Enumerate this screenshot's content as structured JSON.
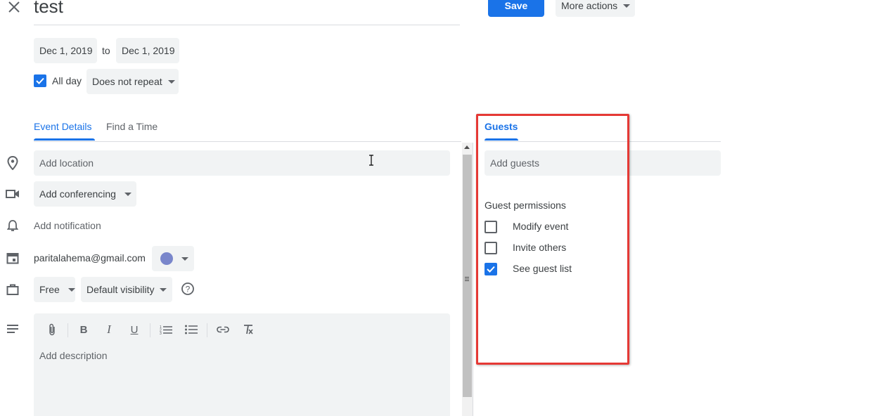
{
  "header": {
    "close_icon": "close-icon",
    "title": "test",
    "save_label": "Save",
    "more_actions_label": "More actions"
  },
  "datetime": {
    "start_date": "Dec 1, 2019",
    "to_label": "to",
    "end_date": "Dec 1, 2019",
    "all_day_label": "All day",
    "all_day_checked": true,
    "repeat_value": "Does not repeat"
  },
  "tabs": {
    "event_details": "Event Details",
    "find_a_time": "Find a Time",
    "active": "event_details"
  },
  "details": {
    "location_placeholder": "Add location",
    "conferencing_label": "Add conferencing",
    "notification_label": "Add notification",
    "calendar_email": "paritalahema@gmail.com",
    "calendar_color": "#7986cb",
    "availability": "Free",
    "visibility": "Default visibility",
    "description_placeholder": "Add description"
  },
  "guests": {
    "tab_label": "Guests",
    "add_placeholder": "Add guests",
    "permissions_title": "Guest permissions",
    "permissions": [
      {
        "label": "Modify event",
        "checked": false
      },
      {
        "label": "Invite others",
        "checked": false
      },
      {
        "label": "See guest list",
        "checked": true
      }
    ]
  },
  "colors": {
    "accent": "#1a73e8",
    "highlight_border": "#e53935",
    "field_bg": "#f1f3f4"
  }
}
